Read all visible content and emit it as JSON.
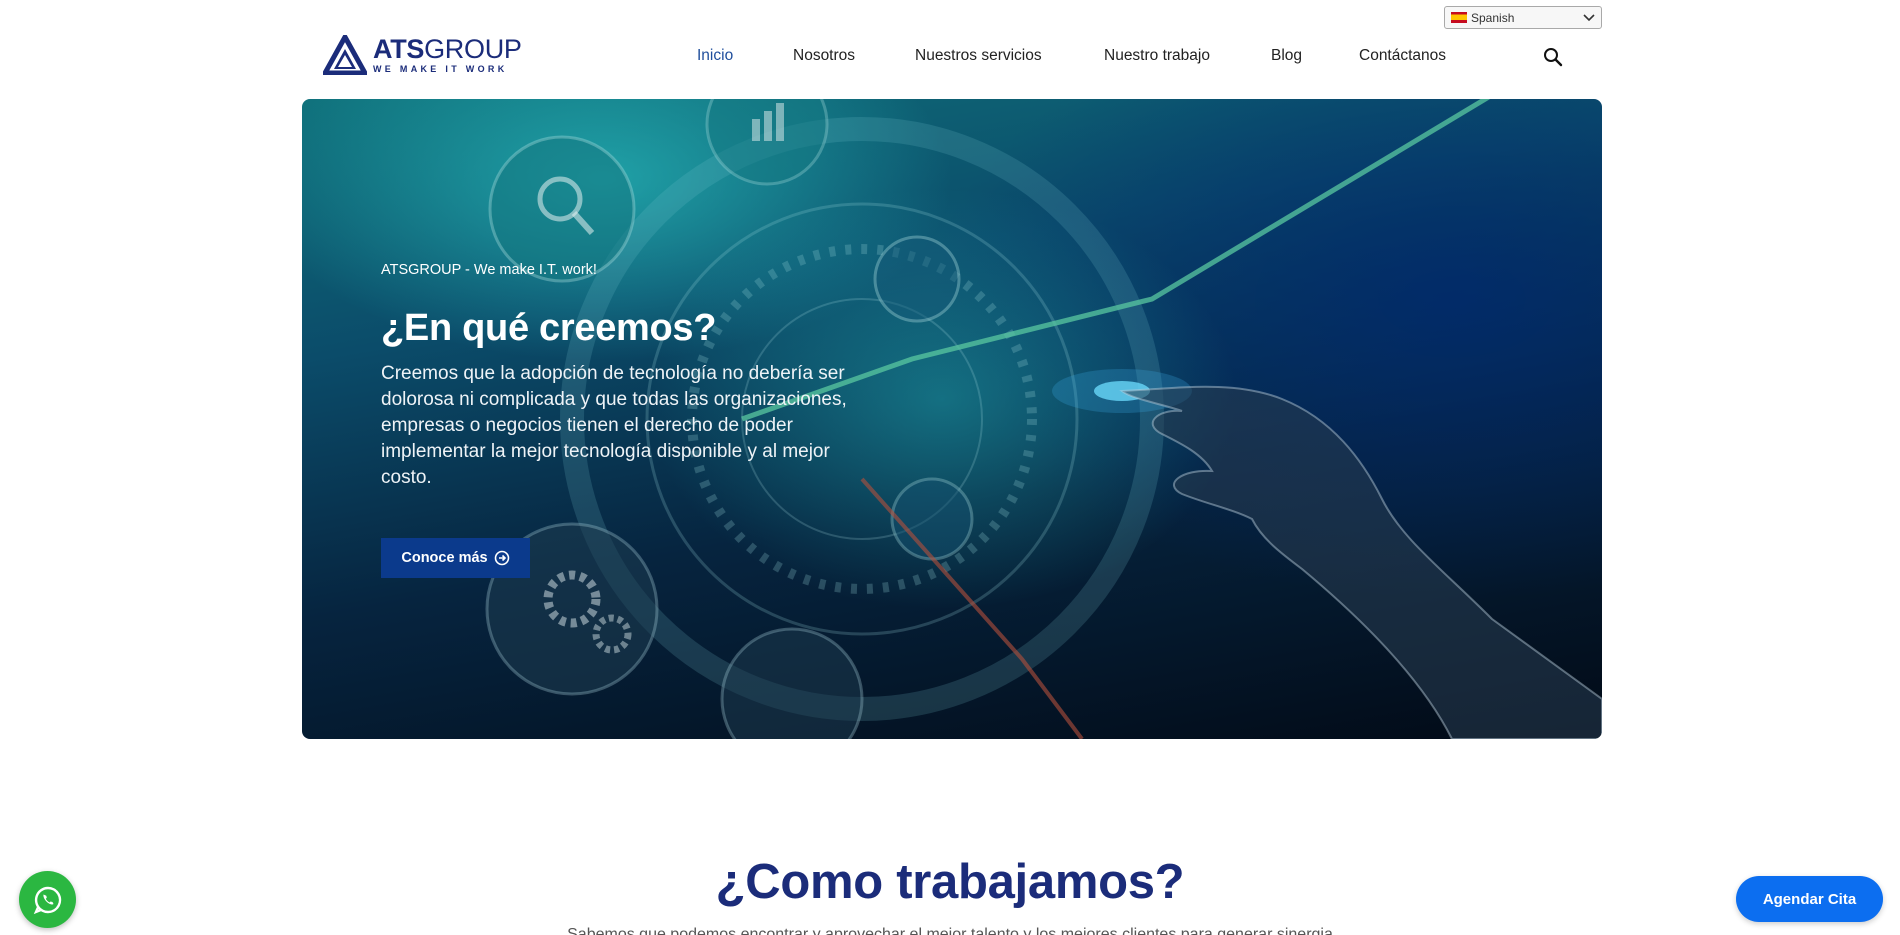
{
  "language": {
    "selected": "Spanish",
    "icon": "chevron-down-icon"
  },
  "logo": {
    "word_bold": "ATS",
    "word_rest": "GROUP",
    "tagline": "WE MAKE IT WORK"
  },
  "nav": {
    "items": [
      {
        "label": "Inicio",
        "active": true
      },
      {
        "label": "Nosotros",
        "active": false
      },
      {
        "label": "Nuestros servicios",
        "active": false
      },
      {
        "label": "Nuestro trabajo",
        "active": false
      },
      {
        "label": "Blog",
        "active": false
      },
      {
        "label": "Contáctanos",
        "active": false
      }
    ],
    "search_icon": "search-icon"
  },
  "hero": {
    "kicker": "ATSGROUP - We make I.T. work!",
    "title": "¿En qué creemos?",
    "body": "Creemos que la adopción de tecnología no debería ser dolorosa ni complicada y que todas las organizaciones, empresas o negocios tienen el derecho de poder implementar la mejor tecnología disponible y al mejor costo.",
    "cta_label": "Conoce más",
    "cta_icon": "arrow-circle-right-icon"
  },
  "section": {
    "title": "¿Como trabajamos?",
    "subtitle": "Sabemos que podemos encontrar y aprovechar el mejor talento y los mejores clientes para generar sinergia"
  },
  "floating": {
    "whatsapp_icon": "whatsapp-icon",
    "agendar_label": "Agendar Cita"
  },
  "colors": {
    "brand": "#1b2c7a",
    "nav_active": "#1f4e9c",
    "cta": "#0b3a8c",
    "agendar": "#0c6ef0",
    "whatsapp": "#2bb741"
  }
}
